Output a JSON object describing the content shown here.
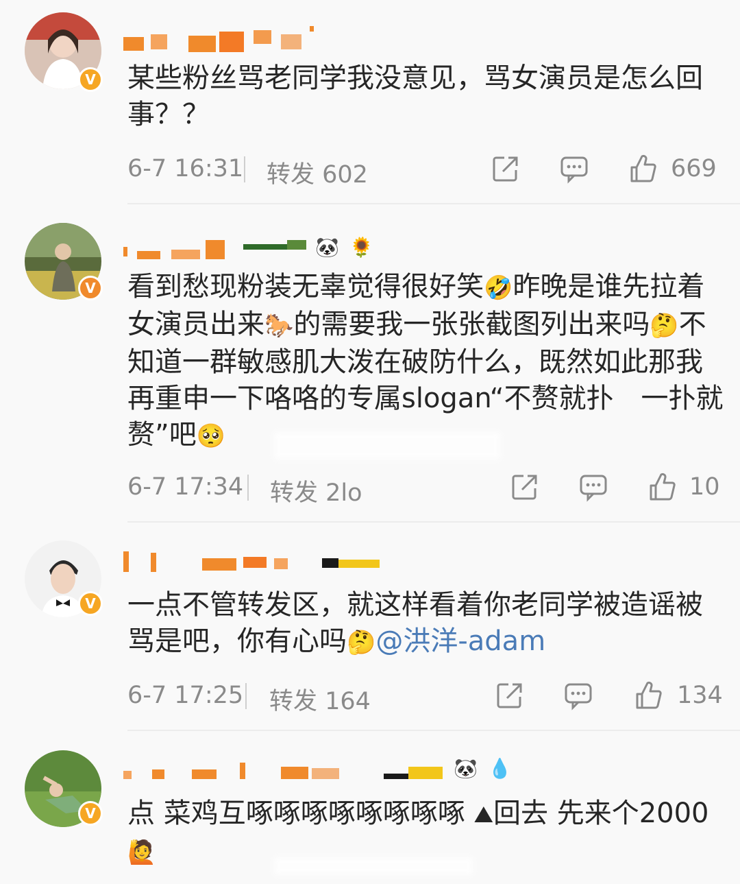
{
  "comments": [
    {
      "text": "某些粉丝骂老同学我没意见，骂女演员是怎么回事？？",
      "time": "6-7 16:31",
      "repost": "转发 602",
      "likes": "669",
      "emojis": []
    },
    {
      "text_parts": {
        "p1": "看到愁现粉装无辜觉得很好笑",
        "e1": "🤣",
        "p2": "昨晚是谁先拉着女演员出来",
        "e2": "🐎",
        "p3": "的需要我一张张截图列出来吗",
        "e3": "🤔",
        "p4": "不知道一群敏感肌大泼在破防什么，既然如此那我再重申一下咯咯的专属slogan“不赘就扑　一扑就赘”吧",
        "e4": "🥺"
      },
      "time": "6-7 17:34",
      "repost": "转发 2lo",
      "likes": "10",
      "emojis": [
        "🐼",
        "🌻"
      ]
    },
    {
      "text_parts": {
        "p1": "一点不管转发区，就这样看着你老同学被造谣被骂是吧，你有心吗",
        "e1": "🤔",
        "mention": "@洪洋-adam"
      },
      "time": "6-7 17:25",
      "repost": "转发 164",
      "likes": "134",
      "emojis": []
    },
    {
      "text_parts": {
        "p1": "点 菜鸡互啄啄啄啄啄啄啄啄 ",
        "e1": "⛰",
        "p2": "回去 先来个2000",
        "e2": "🙋"
      },
      "emojis": [
        "🐼",
        "💧"
      ]
    }
  ],
  "colors": {
    "accent_orange": "#f08a2c",
    "verified_badge": "#f6a623",
    "meta_gray": "#8a8a8a",
    "mention_blue": "#4a7bb7"
  },
  "icons": [
    "share-icon",
    "comment-icon",
    "like-icon"
  ]
}
